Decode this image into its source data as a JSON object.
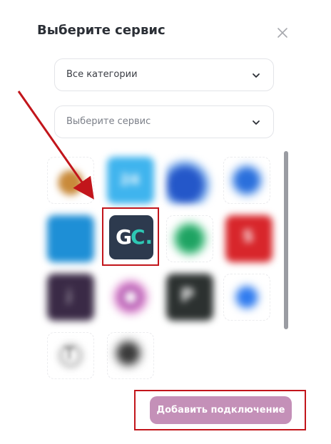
{
  "modal": {
    "title": "Выберите сервис",
    "close_icon": "close-icon"
  },
  "filters": {
    "category_value": "Все категории",
    "service_placeholder": "Выберите сервис"
  },
  "services": {
    "highlighted_logo_text_left": "G",
    "highlighted_logo_text_right": "C.",
    "tile_24_label": "24",
    "tile_s_label": "S",
    "tile_j_label": "j",
    "tile_p_label": "P",
    "tile_t_label": "T"
  },
  "footer": {
    "add_button_label": "Добавить подключение"
  },
  "colors": {
    "accent_button": "#c490b8",
    "highlight_border": "#c2151b",
    "gc_background": "#2d3a4e",
    "gc_teal": "#2ec7b4"
  }
}
